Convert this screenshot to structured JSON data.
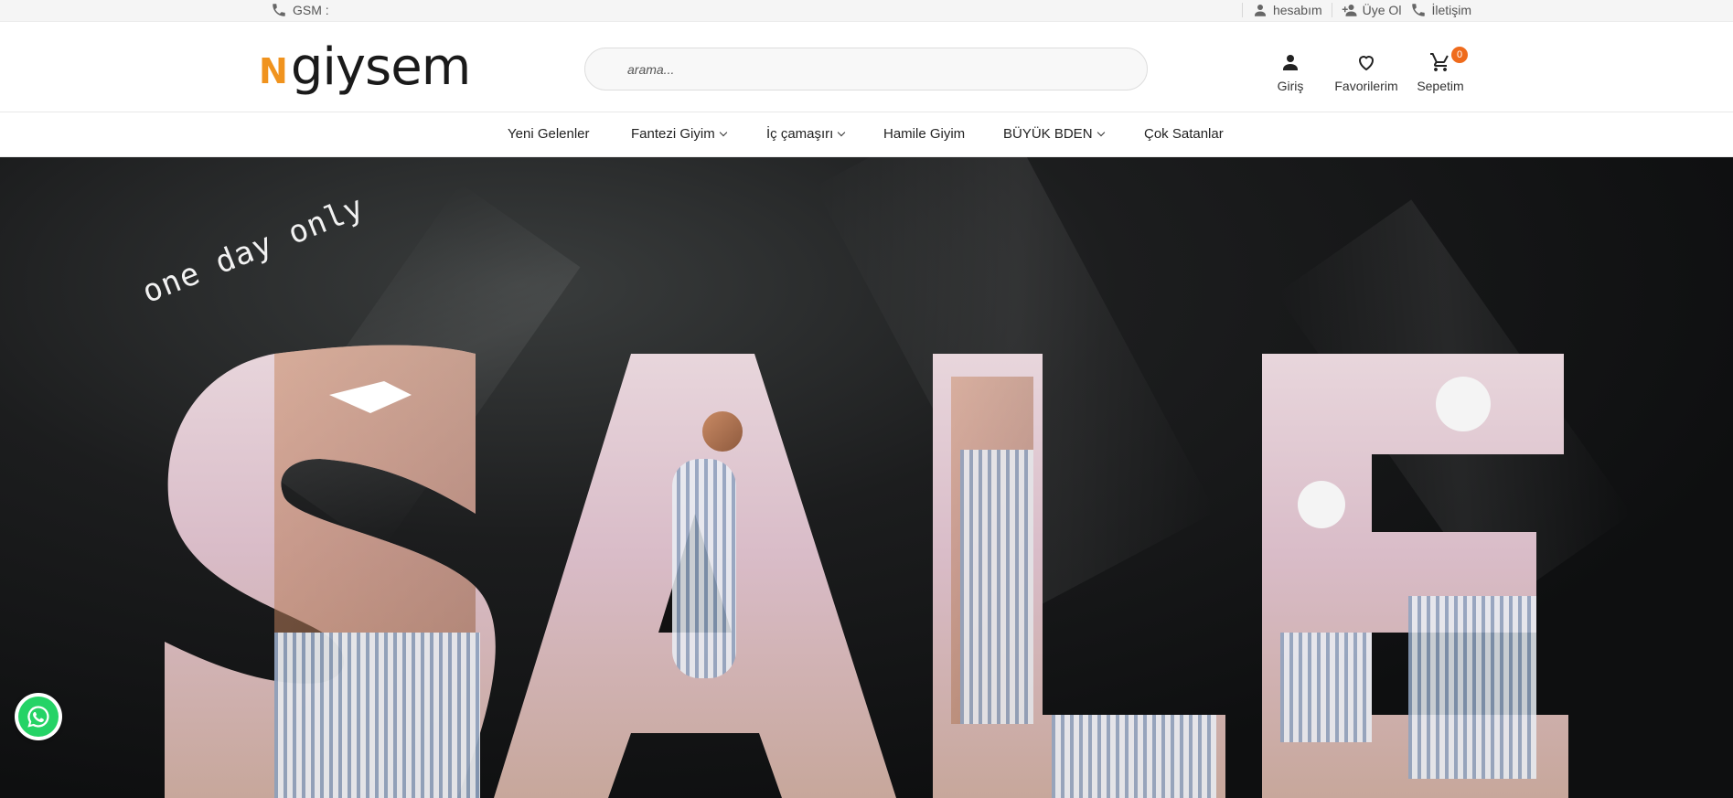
{
  "topbar": {
    "gsm_label": "GSM :",
    "links": [
      {
        "label": "hesabım",
        "icon": "person-icon"
      },
      {
        "label": "Üye Ol",
        "icon": "person-add-icon"
      },
      {
        "label": "İletişim",
        "icon": "phone-icon"
      }
    ]
  },
  "header": {
    "logo_mark": "N",
    "logo_word": "giysem",
    "search_placeholder": "arama...",
    "items": [
      {
        "label": "Giriş",
        "icon": "person-icon"
      },
      {
        "label": "Favorilerim",
        "icon": "heart-icon"
      },
      {
        "label": "Sepetim",
        "icon": "cart-icon",
        "badge": "0"
      }
    ]
  },
  "nav": {
    "items": [
      {
        "label": "Yeni Gelenler",
        "dropdown": false
      },
      {
        "label": "Fantezi Giyim",
        "dropdown": true
      },
      {
        "label": "İç çamaşırı",
        "dropdown": true
      },
      {
        "label": "Hamile Giyim",
        "dropdown": false
      },
      {
        "label": "BÜYÜK BDEN",
        "dropdown": true
      },
      {
        "label": "Çok Satanlar",
        "dropdown": false
      }
    ]
  },
  "hero": {
    "tagline": "one day only",
    "headline": "SALE"
  },
  "colors": {
    "brand_orange": "#f0931e",
    "badge": "#ef6b1c",
    "whatsapp": "#25d366"
  }
}
